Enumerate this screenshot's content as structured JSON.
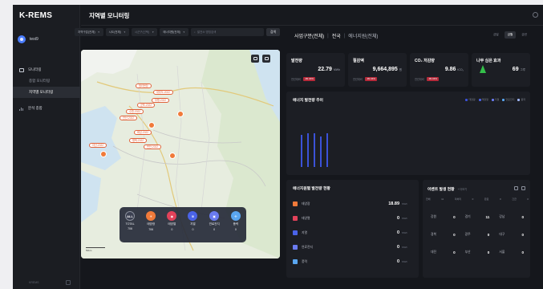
{
  "app": {
    "brand": "K-REMS",
    "page_title": "지역별 모니터링"
  },
  "user": {
    "name": "test9"
  },
  "nav": {
    "monitoring": "모니터링",
    "sub_items": [
      "종합 모니터링",
      "지역별 모니터링"
    ],
    "analysis": "분석 종합"
  },
  "sidebar_footer": "KREMS",
  "filters": {
    "selects": [
      "지역구분(전체)",
      "시도(전체)",
      "시군구(선택)",
      "에너지원(전체)"
    ],
    "search_placeholder": "발전소 명칭검색",
    "search_button": "검색"
  },
  "map": {
    "markers": [
      "청라현장",
      "대부도-2022",
      "부평-2022",
      "군포-2022",
      "수원-2022",
      "안산-2022",
      "화성-2022",
      "평택-2022",
      "아산-2022",
      "천안-2022"
    ],
    "legend": [
      {
        "name": "TOTAL",
        "value": "706",
        "color": "#3c4152",
        "glyph": "ALL"
      },
      {
        "name": "태양광",
        "value": "706",
        "color": "#f07a3a",
        "glyph": "☀"
      },
      {
        "name": "태양열",
        "value": "0",
        "color": "#e2425a",
        "glyph": "◉"
      },
      {
        "name": "지열",
        "value": "0",
        "color": "#4a63e8",
        "glyph": "≋"
      },
      {
        "name": "연료전지",
        "value": "0",
        "color": "#6a7bf0",
        "glyph": "▣"
      },
      {
        "name": "풍력",
        "value": "0",
        "color": "#5aa6f0",
        "glyph": "✢"
      }
    ],
    "scale": "50km"
  },
  "panel": {
    "region": "사업구분(전체)",
    "country": "전국",
    "energy": "에너지원(전체)",
    "tabs": [
      "금일",
      "금월",
      "금년"
    ]
  },
  "stats": [
    {
      "label": "발전량",
      "value": "22.79",
      "unit": "MWh",
      "sub_label": "전년대비",
      "chip": "-99.34%"
    },
    {
      "label": "절감액",
      "value": "9,664,895",
      "unit": "원",
      "sub_label": "전년대비",
      "chip": "-99.34%"
    },
    {
      "label": "CO₂ 저감량",
      "value": "9.86",
      "unit": "tCO₂",
      "sub_label": "전년대비",
      "chip": "-99.34%"
    },
    {
      "label": "나무 심은 효과",
      "value": "69",
      "unit": "그루",
      "sub_label": "",
      "chip": ""
    }
  ],
  "trend": {
    "title": "에너지 발전량 추이",
    "legend": [
      {
        "name": "태양광",
        "color": "#3b52d8"
      },
      {
        "name": "태양열",
        "color": "#4a63e8"
      },
      {
        "name": "지열",
        "color": "#6a7bf0"
      },
      {
        "name": "연료전지",
        "color": "#5aa6f0"
      },
      {
        "name": "풍력",
        "color": "#9fb6f5"
      }
    ]
  },
  "generation": {
    "title": "에너지원별 발전량 현황",
    "rows": [
      {
        "name": "태양광",
        "value": "18.89",
        "unit": "MWh",
        "color": "#f07a3a"
      },
      {
        "name": "태양열",
        "value": "0",
        "unit": "MWh",
        "color": "#e2425a"
      },
      {
        "name": "지열",
        "value": "0",
        "unit": "MWh",
        "color": "#4a63e8"
      },
      {
        "name": "연료전지",
        "value": "0",
        "unit": "MWh",
        "color": "#6a7bf0"
      },
      {
        "name": "풍력",
        "value": "0",
        "unit": "MWh",
        "color": "#5aa6f0"
      }
    ]
  },
  "events": {
    "title": "이벤트 발생 현황",
    "more": "+ 더보기",
    "filters": [
      "전체",
      "11",
      "미처리",
      "0",
      "완료",
      "0",
      "긴급",
      "0"
    ],
    "cells": [
      {
        "name": "강원",
        "value": "0"
      },
      {
        "name": "경기",
        "value": "11"
      },
      {
        "name": "강남",
        "value": "0"
      },
      {
        "name": "경북",
        "value": "0"
      },
      {
        "name": "광주",
        "value": "0"
      },
      {
        "name": "대구",
        "value": "0"
      },
      {
        "name": "대전",
        "value": "0"
      },
      {
        "name": "부산",
        "value": "0"
      },
      {
        "name": "서울",
        "value": "0"
      }
    ]
  }
}
